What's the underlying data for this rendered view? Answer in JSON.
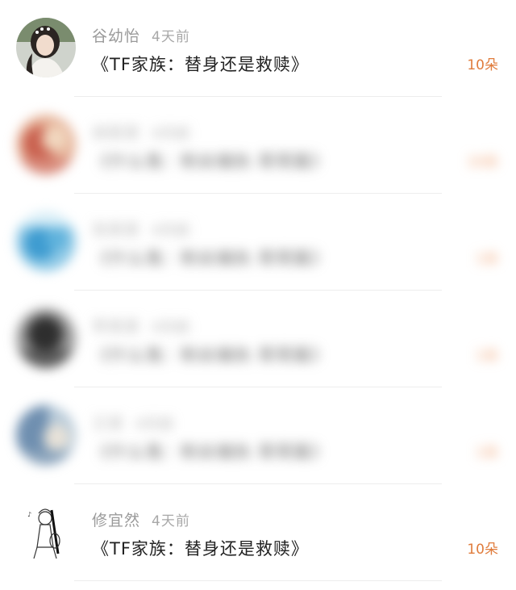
{
  "rows": [
    {
      "name": "谷幼怡",
      "time": "4天前",
      "title": "《TF家族：替身还是救赎》",
      "count": "10朵",
      "avatar_icon": "girl-portrait-avatar",
      "blurred": false
    },
    {
      "name": "胡某某",
      "time": "4天前",
      "title": "《什么鬼：粉丝偏执 哥哥篇》",
      "count": "10朵",
      "avatar_icon": "pink-cartoon-avatar",
      "blurred": true
    },
    {
      "name": "张某某",
      "time": "4天前",
      "title": "《什么鬼：粉丝偏执 哥哥篇》",
      "count": "1朵",
      "avatar_icon": "blue-sky-avatar",
      "blurred": true
    },
    {
      "name": "李某某",
      "time": "4天前",
      "title": "《什么鬼：粉丝偏执 哥哥篇》",
      "count": "1朵",
      "avatar_icon": "dark-gray-avatar",
      "blurred": true
    },
    {
      "name": "王某",
      "time": "4天前",
      "title": "《什么鬼：粉丝偏执 哥哥篇》",
      "count": "1朵",
      "avatar_icon": "blue-photo-avatar",
      "blurred": true
    },
    {
      "name": "修宜然",
      "time": "4天前",
      "title": "《TF家族：替身还是救赎》",
      "count": "10朵",
      "avatar_icon": "sketch-guitar-avatar",
      "blurred": false
    }
  ],
  "colors": {
    "count_accent": "#e07c3c",
    "name_gray": "#9a9a9a",
    "title_dark": "#222222"
  }
}
